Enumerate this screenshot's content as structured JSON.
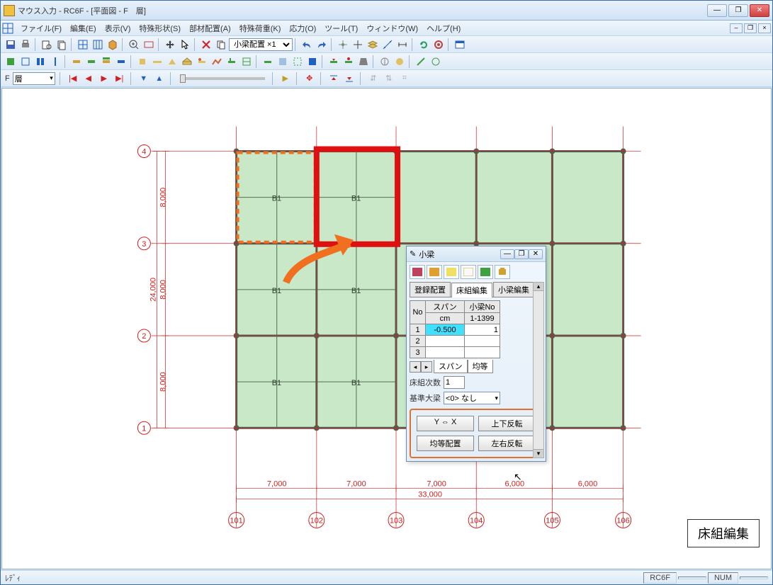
{
  "window": {
    "title": "マウス入力 - RC6F - [平面図 - F　層]"
  },
  "menu": {
    "items": [
      "ファイル(F)",
      "編集(E)",
      "表示(V)",
      "特殊形状(S)",
      "部材配置(A)",
      "特殊荷重(K)",
      "応力(O)",
      "ツール(T)",
      "ウィンドウ(W)",
      "ヘルプ(H)"
    ]
  },
  "toolbar": {
    "combo": "小梁配置 ×1"
  },
  "floor": {
    "label": "F",
    "combo": "層"
  },
  "drawing": {
    "y_axes": [
      "4",
      "3",
      "2",
      "1"
    ],
    "y_dims": [
      "8,000",
      "8,000",
      "8,000"
    ],
    "y_total": "24,000",
    "x_axes": [
      "101",
      "102",
      "103",
      "104",
      "105",
      "106"
    ],
    "x_dims": [
      "7,000",
      "7,000",
      "7,000",
      "6,000",
      "6,000"
    ],
    "x_total": "33,000",
    "beam_tag": "B1"
  },
  "panel": {
    "title": "小梁",
    "tabs": [
      "登録配置",
      "床組編集",
      "小梁編集"
    ],
    "active_tab": 1,
    "col_no": "No",
    "col_span": "スパン",
    "col_beam": "小梁No",
    "unit_span": "cm",
    "unit_beam": "1-1399",
    "rows": [
      {
        "no": "1",
        "span": "-0.500",
        "beam": "1"
      },
      {
        "no": "2",
        "span": "",
        "beam": ""
      },
      {
        "no": "3",
        "span": "",
        "beam": ""
      }
    ],
    "sub_tabs": [
      "スパン",
      "均等"
    ],
    "floor_count_label": "床組次数",
    "floor_count_value": "1",
    "base_beam_label": "基準大梁",
    "base_beam_value": "<0> なし",
    "btn_yx": "Y ⇔ X",
    "btn_ud": "上下反転",
    "btn_equal": "均等配置",
    "btn_lr": "左右反転"
  },
  "big_label": "床組編集",
  "status": {
    "ready": "ﾚﾃﾞｨ",
    "items": [
      "RC6F",
      "",
      "NUM",
      ""
    ]
  }
}
